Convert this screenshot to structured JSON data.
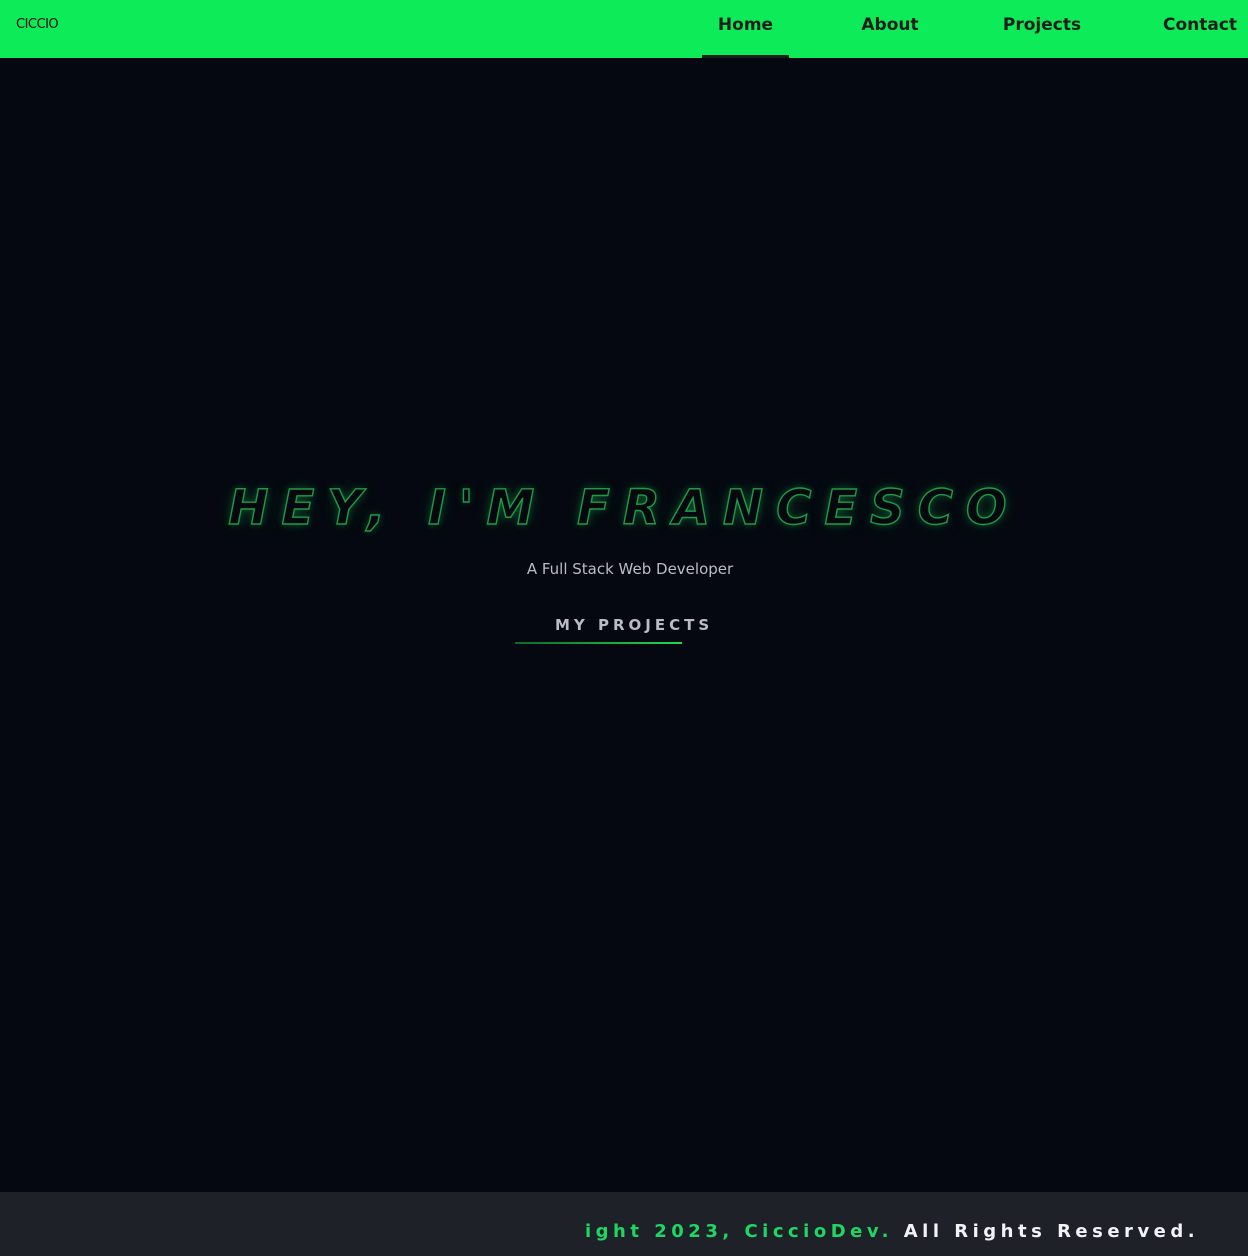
{
  "navbar": {
    "logo": "CICCIO",
    "items": [
      {
        "label": "Home",
        "active": true
      },
      {
        "label": "About",
        "active": false
      },
      {
        "label": "Projects",
        "active": false
      },
      {
        "label": "Contact",
        "active": false
      }
    ]
  },
  "hero": {
    "title": "HEY, I'M FRANCESCO",
    "subtitle": "A Full Stack Web Developer",
    "cta_label": "MY PROJECTS"
  },
  "footer": {
    "text_green": "ight 2023, CiccioDev.",
    "text_white": " All Rights Reserved."
  },
  "colors": {
    "navbar_bg": "#0dec58",
    "page_bg": "#050810",
    "footer_bg": "#1f2129",
    "accent_green": "#1ed760"
  }
}
